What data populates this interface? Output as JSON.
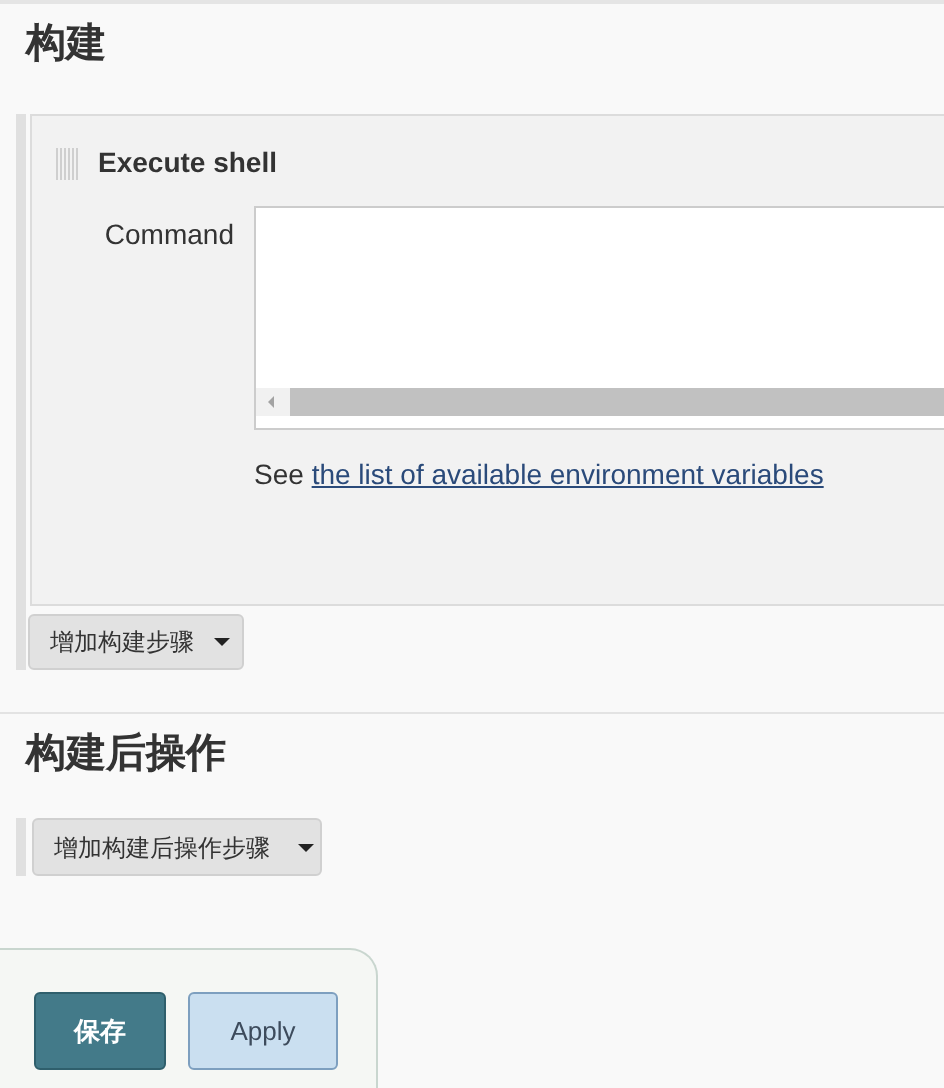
{
  "build": {
    "heading": "构建",
    "step": {
      "title": "Execute shell",
      "command_label": "Command",
      "help_prefix": "See",
      "help_link": "the list of available environment variables"
    },
    "add_button": "增加构建步骤"
  },
  "post_build": {
    "heading": "构建后操作",
    "add_button": "增加构建后操作步骤"
  },
  "buttons": [
    {
      "kind": "primary",
      "label": "保存"
    },
    {
      "kind": "secondary",
      "label": "Apply"
    }
  ]
}
